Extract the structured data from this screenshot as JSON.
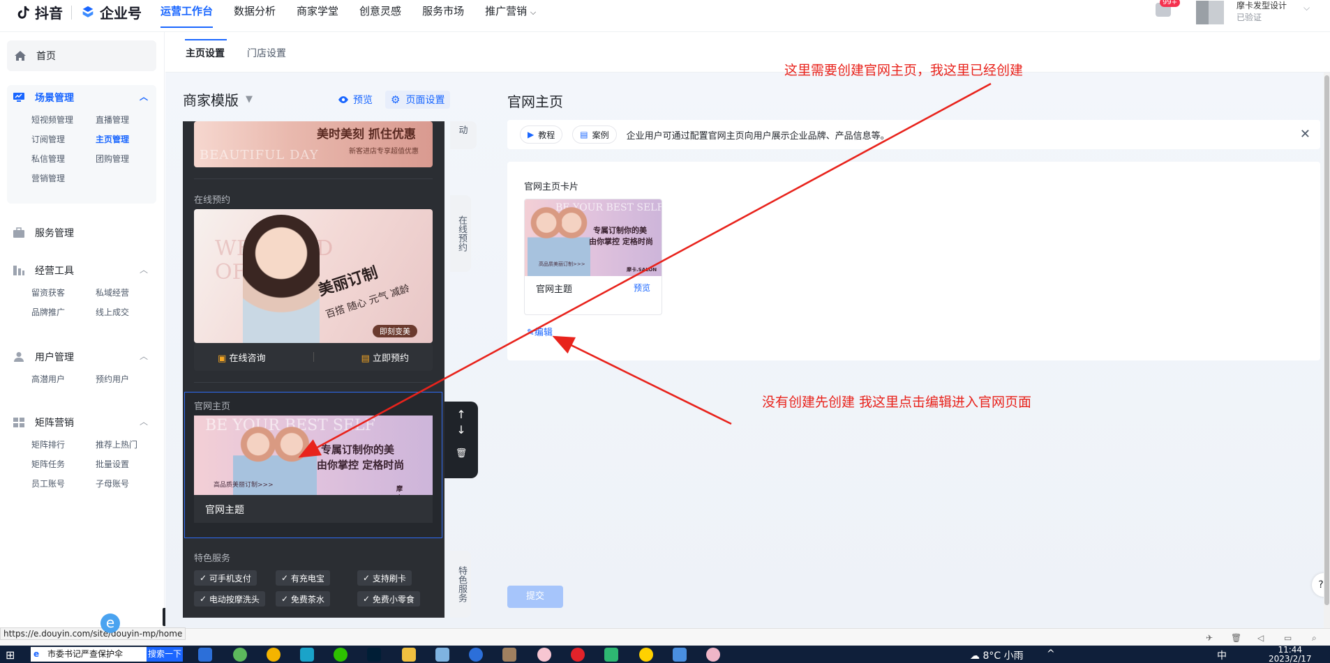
{
  "brand": {
    "douyin": "抖音",
    "qiyehao": "企业号"
  },
  "topnav": {
    "items": [
      "运营工作台",
      "数据分析",
      "商家学堂",
      "创意灵感",
      "服务市场",
      "推广营销"
    ],
    "active": "运营工作台"
  },
  "notifications": {
    "badge": "99+"
  },
  "account": {
    "name": "摩卡发型设计",
    "status": "已验证"
  },
  "sidebar": {
    "home": "首页",
    "groups": [
      {
        "title": "场景管理",
        "items": [
          "短视频管理",
          "直播管理",
          "订阅管理",
          "主页管理",
          "私信管理",
          "团购管理",
          "营销管理"
        ],
        "active_item": "主页管理"
      },
      {
        "title": "服务管理",
        "items": []
      },
      {
        "title": "经营工具",
        "items": [
          "留资获客",
          "私域经营",
          "品牌推广",
          "线上成交"
        ]
      },
      {
        "title": "用户管理",
        "items": [
          "高潜用户",
          "预约用户"
        ]
      },
      {
        "title": "矩阵营销",
        "items": [
          "矩阵排行",
          "推荐上热门",
          "矩阵任务",
          "批量设置",
          "员工账号",
          "子母账号"
        ]
      }
    ],
    "collapse": "«"
  },
  "tabs": [
    "主页设置",
    "门店设置"
  ],
  "editor": {
    "template": "商家模版",
    "preview": "预览",
    "page_settings": "页面设置",
    "banner_top": {
      "title": "美时美刻 抓住优惠",
      "sub": "新客进店专享超值优惠",
      "bg_text": "BEAUTIFUL DAY"
    },
    "online_booking": {
      "label": "在线预约",
      "headline": "美丽订制",
      "sub": "百搭 随心 元气 减龄",
      "cta": "即刻变美",
      "bg_text": "WEEKEND OFFER",
      "consult": "在线咨询",
      "book": "立即预约"
    },
    "official": {
      "label": "官网主页",
      "banner_bg": "BE YOUR BEST SELF",
      "banner_title": "专属订制你的美",
      "banner_sub": "由你掌控 定格时尚",
      "banner_small": "高品质美丽订制>>>",
      "brand": "摩卡.SALON",
      "caption": "官网主题"
    },
    "features": {
      "label": "特色服务",
      "chips": [
        "可手机支付",
        "有充电宝",
        "支持刷卡",
        "电动按摩洗头",
        "免费茶水",
        "免费小零食"
      ]
    },
    "side_tags": {
      "activity_tail": "动",
      "booking": "在线预约",
      "features": "特色服务"
    },
    "toolbar": {
      "up": "↑",
      "down": "↓",
      "delete": "🗑"
    }
  },
  "right": {
    "title": "官网主页",
    "notice": {
      "tutorial": "教程",
      "example": "案例",
      "text": "企业用户可通过配置官网主页向用户展示企业品牌、产品信息等。",
      "close": "✕"
    },
    "card_label": "官网主页卡片",
    "card": {
      "name": "官网主题",
      "preview": "预览",
      "img_title": "专属订制你的美",
      "img_sub": "由你掌控 定格时尚",
      "img_bg": "BE YOUR BEST SELF",
      "img_small": "高品质美丽订制>>>",
      "img_brand": "摩卡.SALON"
    },
    "edit": "编辑",
    "submit": "提交"
  },
  "annotations": {
    "top": "这里需要创建官网主页，我这里已经创建",
    "bottom": "没有创建先创建 我这里点击编辑进入官网页面"
  },
  "status_url": "https://e.douyin.com/site/douyin-mp/home",
  "help": "?",
  "taskbar": {
    "search": "市委书记严查保护伞",
    "search_btn": "搜索一下",
    "weather": "8°C 小雨",
    "ime": "中",
    "time": "11:44",
    "date": "2023/2/17"
  },
  "colors": {
    "accent": "#1966ff",
    "annotation": "#e8231c",
    "notif_badge": "#f5314f"
  }
}
